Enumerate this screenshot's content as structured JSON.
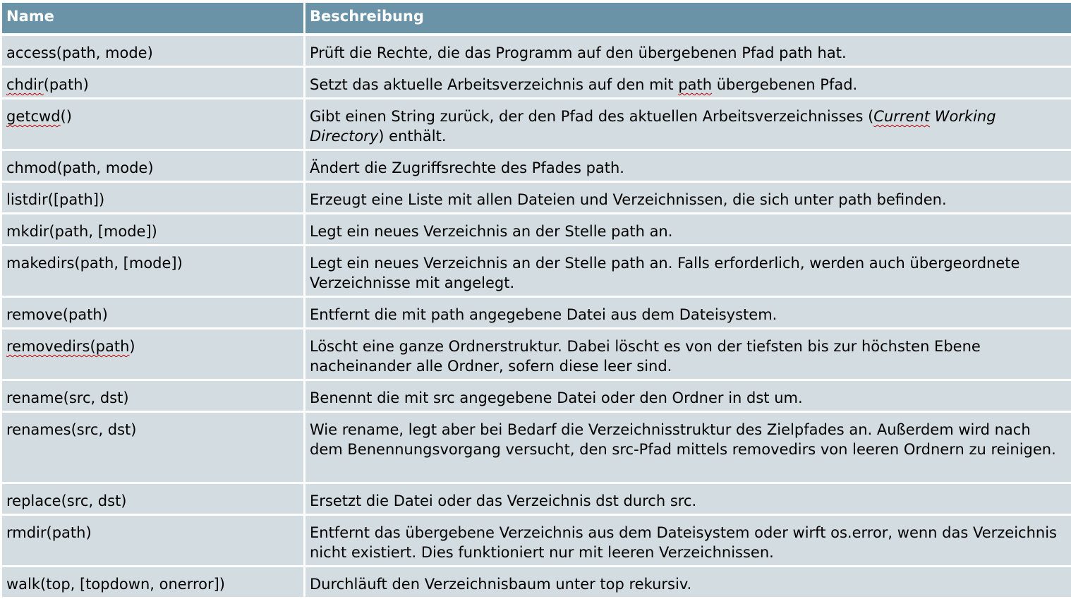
{
  "table": {
    "headers": {
      "name": "Name",
      "description": "Beschreibung"
    },
    "rows": [
      {
        "name": "access(path, mode)",
        "desc": "Prüft die Rechte, die das Programm auf den übergebenen Pfad path hat."
      },
      {
        "name_pre": "",
        "name_mark": "chdir",
        "name_post": "(path)",
        "desc_pre": "Setzt das aktuelle Arbeitsverzeichnis auf den mit ",
        "desc_mark": "path",
        "desc_post": " übergebenen Pfad."
      },
      {
        "name_mark": "getcwd",
        "name_post": "()",
        "desc_pre": "Gibt einen String zurück, der den Pfad des aktuellen Arbeitsverzeichnisses (",
        "desc_ital_mark": "Current",
        "desc_ital": " Working Directory",
        "desc_post": ") enthält."
      },
      {
        "name": "chmod(path, mode)",
        "desc": "Ändert die Zugriffsrechte des Pfades path."
      },
      {
        "name": "listdir([path])",
        "desc": "Erzeugt eine Liste mit allen Dateien und Verzeichnissen, die sich unter path befinden."
      },
      {
        "name": "mkdir(path, [mode])",
        "desc": "Legt ein neues Verzeichnis an der Stelle path an."
      },
      {
        "name": "makedirs(path, [mode])",
        "desc": "Legt ein neues Verzeichnis an der Stelle path an. Falls erforderlich, werden auch übergeordnete Verzeichnisse mit angelegt."
      },
      {
        "name": "remove(path)",
        "desc": "Entfernt die mit path angegebene Datei aus dem Dateisystem."
      },
      {
        "name_mark": "removedirs(path",
        "name_post": ")",
        "desc": "Löscht eine ganze Ordnerstruktur. Dabei löscht es von der tiefsten bis zur höchsten Ebene nacheinander alle Ordner, sofern diese leer sind."
      },
      {
        "name": "rename(src, dst)",
        "desc": "Benennt die mit src angegebene Datei oder den Ordner in dst um."
      },
      {
        "name": "renames(src, dst)",
        "desc": "Wie rename, legt aber bei Bedarf die Verzeichnisstruktur des Zielpfades an. Außerdem wird nach dem Benennungsvorgang versucht, den src-Pfad mittels removedirs von leeren Ordnern zu reinigen."
      },
      {
        "name": "replace(src, dst)",
        "desc": "Ersetzt die Datei oder das Verzeichnis dst durch src."
      },
      {
        "name": "rmdir(path)",
        "desc": "Entfernt das übergebene Verzeichnis aus dem Dateisystem oder wirft os.error, wenn das Verzeichnis nicht existiert. Dies funktioniert nur mit leeren Verzeichnissen."
      },
      {
        "name": "walk(top, [topdown, onerror])",
        "desc": "Durchläuft den Verzeichnisbaum unter top rekursiv."
      }
    ]
  },
  "colors": {
    "header_bg": "#6a93a8",
    "row_bg": "#d2dce1",
    "spellcheck_underline": "#c00000"
  }
}
